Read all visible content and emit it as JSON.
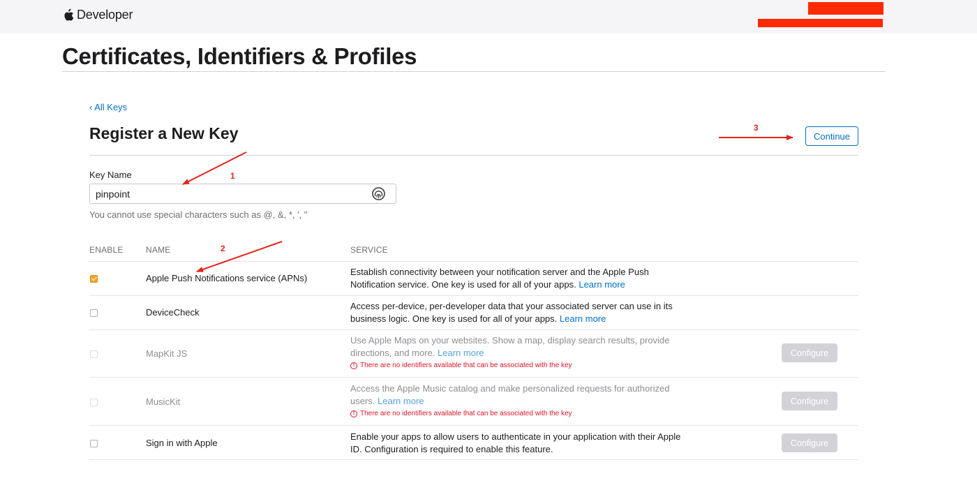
{
  "header": {
    "brand_icon": "apple-logo-icon",
    "brand_label": "Developer"
  },
  "page": {
    "title": "Certificates, Identifiers & Profiles"
  },
  "nav": {
    "back_label": "‹ All Keys"
  },
  "section": {
    "title": "Register a New Key",
    "continue_label": "Continue"
  },
  "form": {
    "key_name_label": "Key Name",
    "key_name_value": "pinpoint",
    "key_name_icon": "autofill-key-icon",
    "hint": "You cannot use special characters such as @, &, *, ', \""
  },
  "table": {
    "headers": {
      "enable": "ENABLE",
      "name": "NAME",
      "service": "SERVICE"
    },
    "rows": [
      {
        "checked": true,
        "enabled": true,
        "name": "Apple Push Notifications service (APNs)",
        "description": "Establish connectivity between your notification server and the Apple Push Notification service. One key is used for all of your apps.",
        "learn_more": "Learn more"
      },
      {
        "checked": false,
        "enabled": true,
        "name": "DeviceCheck",
        "description": "Access per-device, per-developer data that your associated server can use in its business logic. One key is used for all of your apps.",
        "learn_more": "Learn more"
      },
      {
        "checked": false,
        "enabled": false,
        "name": "MapKit JS",
        "description": "Use Apple Maps on your websites. Show a map, display search results, provide directions, and more.",
        "learn_more": "Learn more",
        "error": "There are no identifiers available that can be associated with the key",
        "configure_label": "Configure"
      },
      {
        "checked": false,
        "enabled": false,
        "name": "MusicKit",
        "description": "Access the Apple Music catalog and make personalized requests for authorized users.",
        "learn_more": "Learn more",
        "error": "There are no identifiers available that can be associated with the key",
        "configure_label": "Configure"
      },
      {
        "checked": false,
        "enabled": true,
        "name": "Sign in with Apple",
        "description": "Enable your apps to allow users to authenticate in your application with their Apple ID. Configuration is required to enable this feature.",
        "configure_label": "Configure"
      }
    ]
  },
  "annotations": {
    "step1": "1",
    "step2": "2",
    "step3": "3",
    "color": "#e5231b"
  },
  "colors": {
    "accent": "#0070c9",
    "checkbox_checked": "#f5a623",
    "error": "#e0152a",
    "redaction": "#ff2a00"
  }
}
